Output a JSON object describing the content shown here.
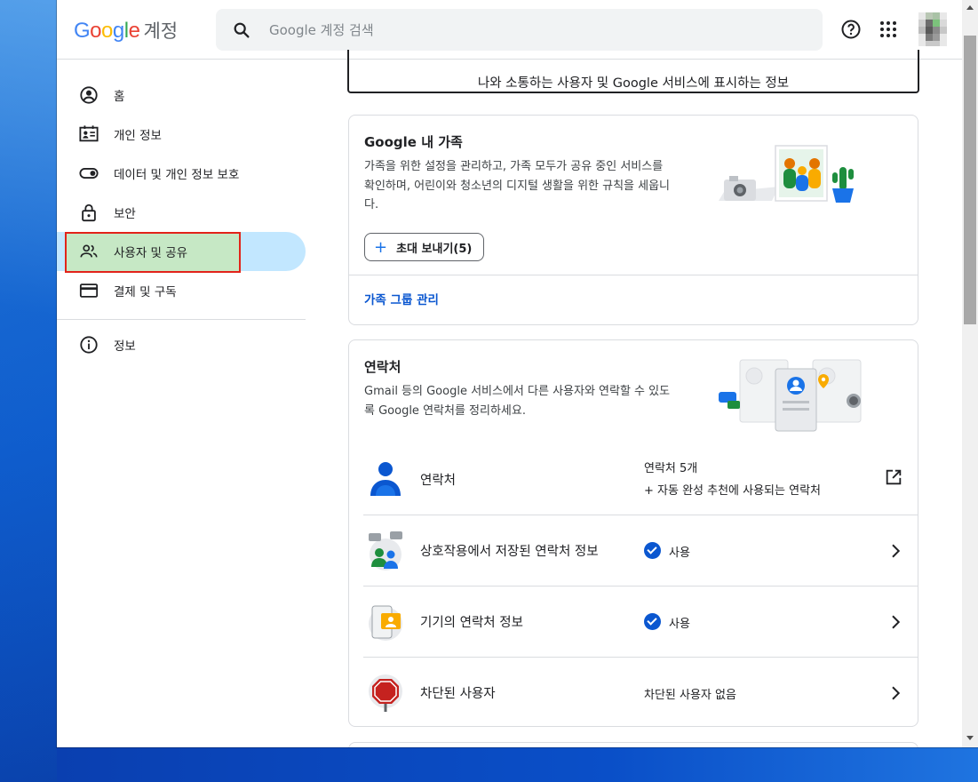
{
  "header": {
    "logo": {
      "g1": "G",
      "o1": "o",
      "o2": "o",
      "g2": "g",
      "l": "l",
      "e": "e",
      "product": "계정"
    },
    "search_placeholder": "Google 계정 검색",
    "icons": [
      "help-icon",
      "apps-icon",
      "avatar"
    ]
  },
  "sidebar": {
    "items": [
      {
        "label": "홈",
        "icon": "account-circle-icon"
      },
      {
        "label": "개인 정보",
        "icon": "id-card-icon"
      },
      {
        "label": "데이터 및 개인 정보 보호",
        "icon": "toggle-icon"
      },
      {
        "label": "보안",
        "icon": "lock-icon"
      },
      {
        "label": "사용자 및 공유",
        "icon": "people-icon",
        "active": true
      },
      {
        "label": "결제 및 구독",
        "icon": "credit-card-icon"
      }
    ],
    "info": {
      "label": "정보",
      "icon": "info-icon"
    }
  },
  "top_card": {
    "text": "나와 소통하는 사용자 및 Google 서비스에 표시하는 정보"
  },
  "family": {
    "title": "Google 내 가족",
    "desc": "가족을 위한 설정을 관리하고, 가족 모두가 공유 중인 서비스를 확인하며, 어린이와 청소년의 디지털 생활을 위한 규칙을 세웁니다.",
    "invite_label": "초대 보내기(5)",
    "manage_link": "가족 그룹 관리"
  },
  "contacts": {
    "title": "연락처",
    "desc": "Gmail 등의 Google 서비스에서 다른 사용자와 연락할 수 있도록 Google 연락처를 정리하세요.",
    "rows": [
      {
        "title": "연락처",
        "value1": "연락처 5개",
        "value2": "+ 자동 완성 추천에 사용되는 연락처"
      },
      {
        "title": "상호작용에서 저장된 연락처 정보",
        "value": "사용"
      },
      {
        "title": "기기의 연락처 정보",
        "value": "사용"
      },
      {
        "title": "차단된 사용자",
        "value": "차단된 사용자 없음"
      }
    ]
  },
  "colors": {
    "accent": "#0b57d0",
    "active_pill": "#c2e7ff",
    "highlight": "#c6e8c5",
    "highlight_border": "#e2231a"
  }
}
